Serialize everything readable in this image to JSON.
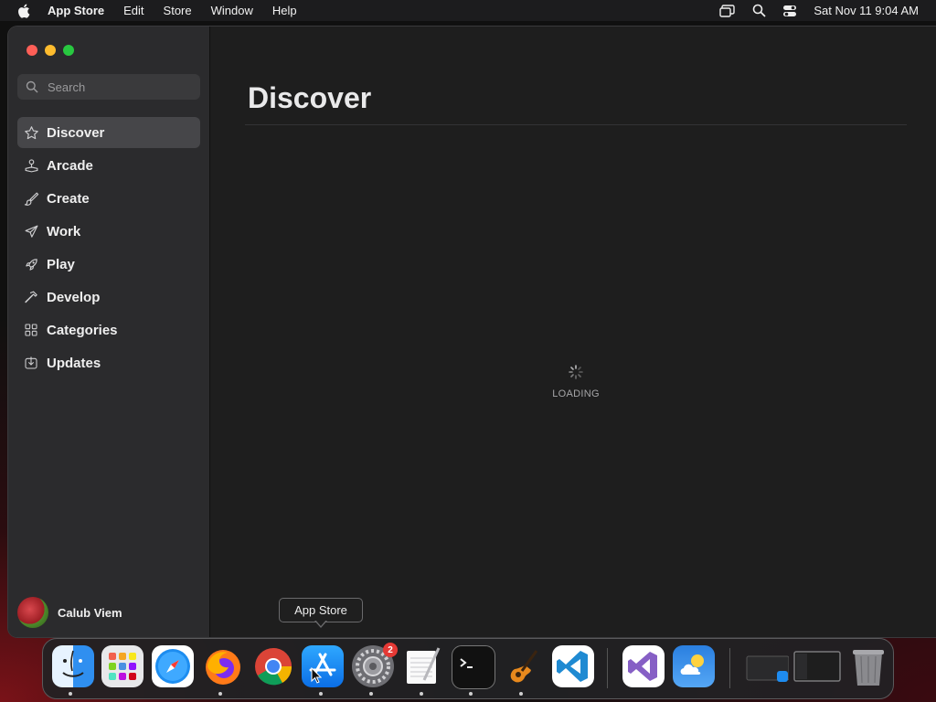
{
  "menubar": {
    "app_name": "App Store",
    "items": [
      "Edit",
      "Store",
      "Window",
      "Help"
    ],
    "clock": "Sat Nov 11  9:04 AM"
  },
  "search": {
    "placeholder": "Search"
  },
  "sidebar": {
    "items": [
      {
        "label": "Discover",
        "icon": "star-icon",
        "active": true
      },
      {
        "label": "Arcade",
        "icon": "joystick-icon"
      },
      {
        "label": "Create",
        "icon": "brush-icon"
      },
      {
        "label": "Work",
        "icon": "paper-plane-icon"
      },
      {
        "label": "Play",
        "icon": "rocket-icon"
      },
      {
        "label": "Develop",
        "icon": "hammer-icon"
      },
      {
        "label": "Categories",
        "icon": "grid-icon"
      },
      {
        "label": "Updates",
        "icon": "download-icon"
      }
    ],
    "user": {
      "name": "Calub Viem"
    }
  },
  "main": {
    "title": "Discover",
    "loading_text": "LOADING"
  },
  "tooltip": {
    "text": "App Store"
  },
  "dock": {
    "items": [
      {
        "name": "finder-icon",
        "color": "#3b8fe8"
      },
      {
        "name": "launchpad-icon",
        "color": "#e8e8ea"
      },
      {
        "name": "safari-icon",
        "color": "#1d8df0"
      },
      {
        "name": "firefox-icon",
        "color": "#ff7a18"
      },
      {
        "name": "chrome-icon",
        "color": "#ffffff"
      },
      {
        "name": "app-store-icon",
        "color": "#1a8cff"
      },
      {
        "name": "system-settings-icon",
        "color": "#8e8e93",
        "badge": "2"
      },
      {
        "name": "textedit-icon",
        "color": "#f5f5f5"
      },
      {
        "name": "terminal-icon",
        "color": "#111111"
      },
      {
        "name": "garageband-icon",
        "color": "#2a2a2a"
      },
      {
        "name": "vscode-icon",
        "color": "#ffffff"
      },
      {
        "name": "visual-studio-icon",
        "color": "#ffffff"
      },
      {
        "name": "weather-icon",
        "color": "#2f8ae8"
      },
      {
        "name": "recent-window-icon",
        "color": "#2a2a2c"
      },
      {
        "name": "minimized-window-icon",
        "color": "#1e1e1e"
      },
      {
        "name": "trash-icon",
        "color": "#9a9a9c"
      }
    ]
  }
}
